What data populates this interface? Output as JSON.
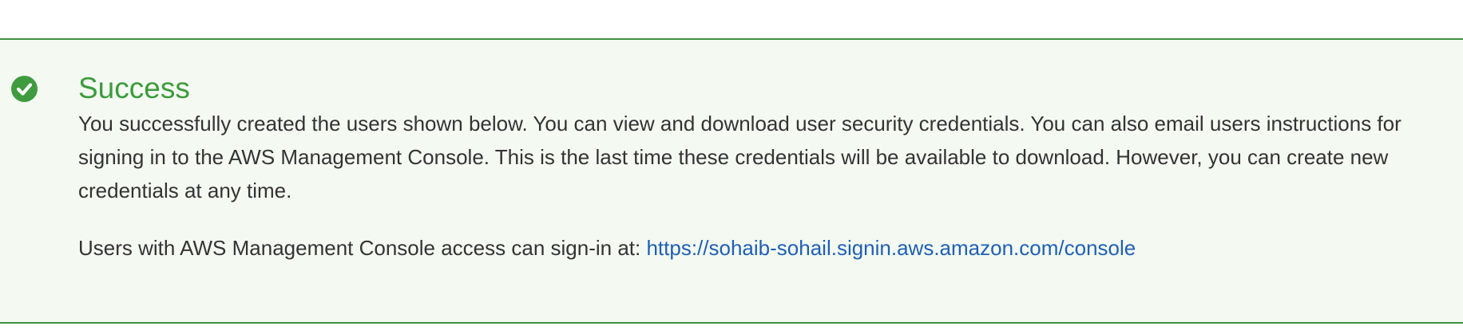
{
  "alert": {
    "status": "success",
    "icon": "check-circle-icon",
    "colors": {
      "accent": "#3c9b3c",
      "background": "#f4faf2",
      "border": "#3f8f3f",
      "link": "#1f5fb5",
      "text": "#333333"
    },
    "title": "Success",
    "message": "You successfully created the users shown below. You can view and download user security credentials. You can also email users instructions for signing in to the AWS Management Console. This is the last time these credentials will be available to download. However, you can create new credentials at any time.",
    "signin_prefix": "Users with AWS Management Console access can sign-in at: ",
    "signin_url": "https://sohaib-sohail.signin.aws.amazon.com/console"
  }
}
